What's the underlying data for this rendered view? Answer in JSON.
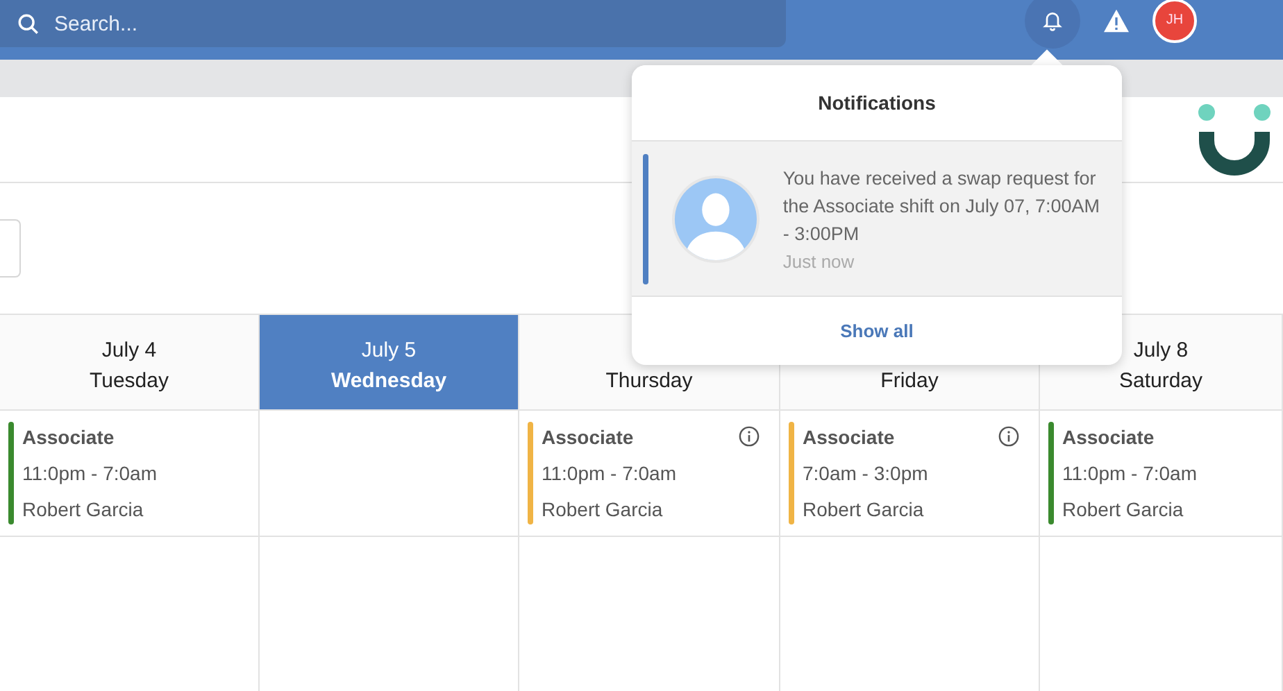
{
  "topbar": {
    "search": {
      "placeholder": "Search..."
    },
    "avatar": {
      "initials": "JH"
    }
  },
  "notifications": {
    "title": "Notifications",
    "items": [
      {
        "message": "You have received a swap request for the Associate shift on July 07, 7:00AM - 3:00PM",
        "time": "Just now",
        "unread": true
      }
    ],
    "show_all": "Show all"
  },
  "days": [
    {
      "date": "July 4",
      "weekday": "Tuesday",
      "selected": false,
      "shift": {
        "role": "Associate",
        "time": "11:0pm - 7:0am",
        "person": "Robert Garcia",
        "color": "#3a8a2e",
        "info": false
      }
    },
    {
      "date": "July 5",
      "weekday": "Wednesday",
      "selected": true
    },
    {
      "weekday": "Thursday",
      "selected": false,
      "shift": {
        "role": "Associate",
        "time": "11:0pm - 7:0am",
        "person": "Robert Garcia",
        "color": "#f0b445",
        "info": true
      }
    },
    {
      "weekday": "Friday",
      "selected": false,
      "shift": {
        "role": "Associate",
        "time": "7:0am - 3:0pm",
        "person": "Robert Garcia",
        "color": "#f0b445",
        "info": true
      }
    },
    {
      "date": "July 8",
      "weekday": "Saturday",
      "selected": false,
      "shift": {
        "role": "Associate",
        "time": "11:0pm - 7:0am",
        "person": "Robert Garcia",
        "color": "#3a8a2e",
        "info": false
      }
    }
  ]
}
